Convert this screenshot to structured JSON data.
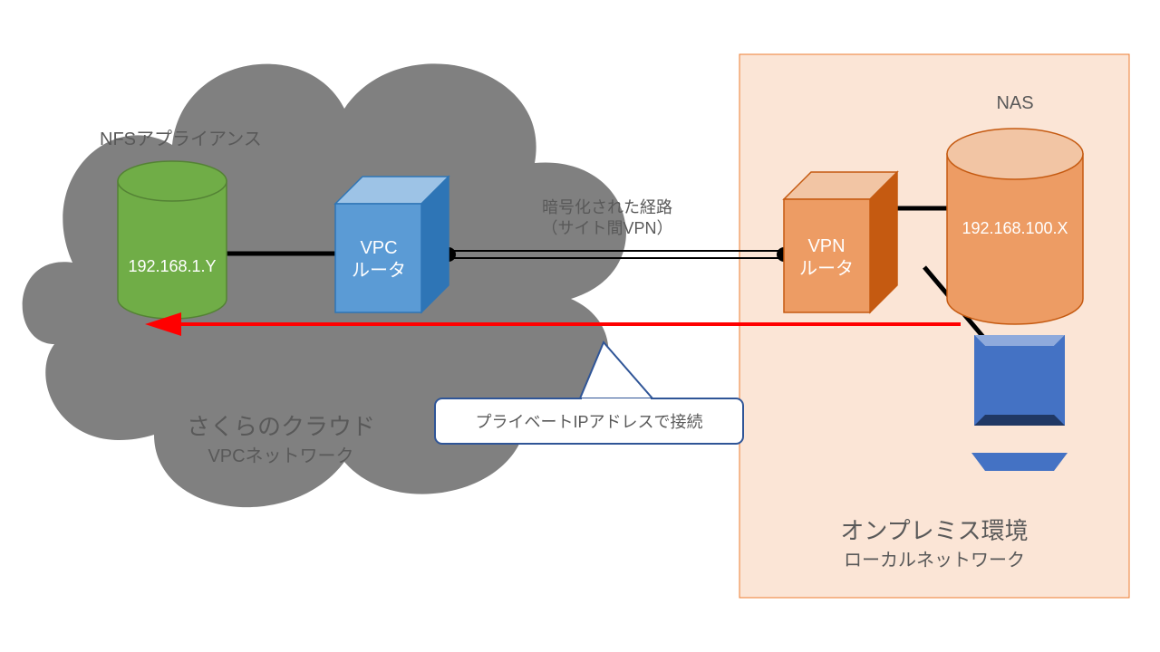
{
  "cloud": {
    "title": "さくらのクラウド",
    "subtitle": "VPCネットワーク",
    "nfs_label": "NFSアプライアンス",
    "nfs_ip": "192.168.1.Y",
    "vpc_router_l1": "VPC",
    "vpc_router_l2": "ルータ"
  },
  "link": {
    "encrypted_l1": "暗号化された経路",
    "encrypted_l2": "（サイト間VPN）"
  },
  "onprem": {
    "title": "オンプレミス環境",
    "subtitle": "ローカルネットワーク",
    "vpn_router_l1": "VPN",
    "vpn_router_l2": "ルータ",
    "nas_label": "NAS",
    "nas_ip": "192.168.100.X"
  },
  "callout": {
    "text": "プライベートIPアドレスで接続"
  }
}
